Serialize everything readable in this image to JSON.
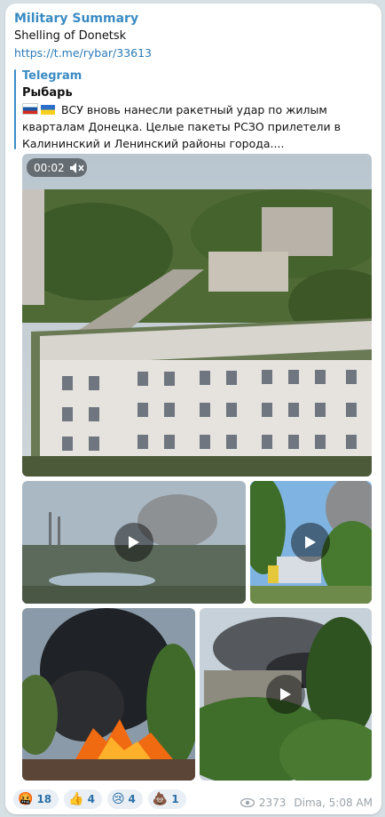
{
  "post": {
    "channel": "Military Summary",
    "title": "Shelling of Donetsk",
    "link": "https://t.me/rybar/33613"
  },
  "forward": {
    "source": "Telegram",
    "author": "Рыбарь",
    "text": "ВСУ вновь нанесли ракетный удар по жилым кварталам Донецка. Целые пакеты РСЗО прилетели в Калининский и Ленинский районы города...."
  },
  "video": {
    "time": "00:02"
  },
  "reactions": [
    {
      "emoji": "🤬",
      "count": "18"
    },
    {
      "emoji": "👍",
      "count": "4"
    },
    {
      "emoji": "😢",
      "count": "4"
    },
    {
      "emoji": "💩",
      "count": "1"
    }
  ],
  "meta": {
    "views": "2373",
    "author_time": "Dima, 5:08 AM"
  },
  "icons": {
    "mute": "mute-icon",
    "play": "play-icon",
    "views": "eye-icon"
  }
}
